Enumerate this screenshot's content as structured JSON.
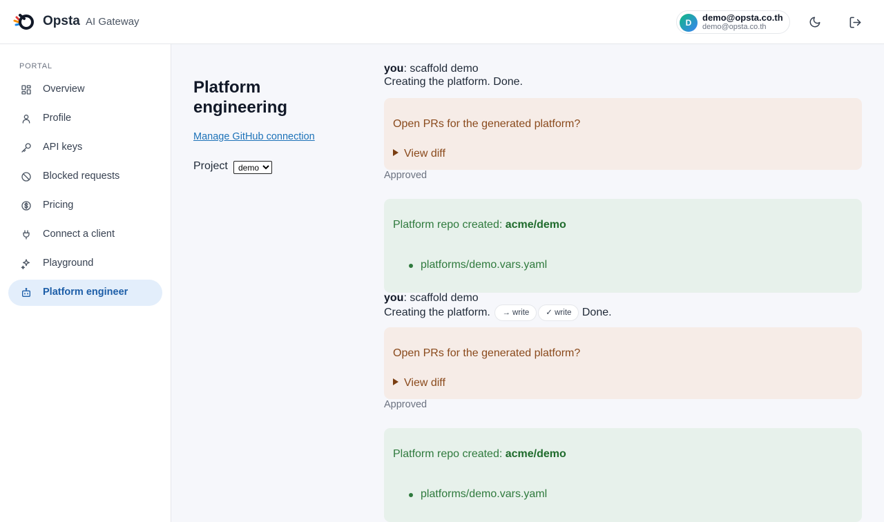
{
  "header": {
    "brand": "Opsta",
    "brand_sub": "AI Gateway",
    "user": {
      "avatar_letter": "D",
      "name": "demo@opsta.co.th",
      "email": "demo@opsta.co.th"
    },
    "theme_toggle_icon": "moon-icon",
    "logout_icon": "logout-icon"
  },
  "sidebar": {
    "section": "PORTAL",
    "items": [
      {
        "label": "Overview",
        "icon": "grid-icon",
        "active": false
      },
      {
        "label": "Profile",
        "icon": "user-icon",
        "active": false
      },
      {
        "label": "API keys",
        "icon": "key-icon",
        "active": false
      },
      {
        "label": "Blocked requests",
        "icon": "ban-icon",
        "active": false
      },
      {
        "label": "Pricing",
        "icon": "dollar-icon",
        "active": false
      },
      {
        "label": "Connect a client",
        "icon": "plug-icon",
        "active": false
      },
      {
        "label": "Playground",
        "icon": "sparkles-icon",
        "active": false
      },
      {
        "label": "Platform engineer",
        "icon": "bot-icon",
        "active": true
      }
    ]
  },
  "main": {
    "title": "Platform engineering",
    "github_link": "Manage GitHub connection",
    "project_label": "Project",
    "project_value": "demo"
  },
  "chat": {
    "blocks": [
      {
        "speaker": "you",
        "message": ": scaffold demo",
        "status_prefix": "Creating the platform.",
        "pills": [],
        "status_suffix": " Done.",
        "pr_question": "Open PRs for the generated platform?",
        "view_diff": "View diff",
        "approved": "Approved",
        "repo_label": "Platform repo created: ",
        "repo_name": "acme/demo",
        "file": "platforms/demo.vars.yaml"
      },
      {
        "speaker": "you",
        "message": ": scaffold demo",
        "status_prefix": "Creating the platform.",
        "pills": [
          "→ write",
          "✓ write"
        ],
        "status_suffix": "Done.",
        "pr_question": "Open PRs for the generated platform?",
        "view_diff": "View diff",
        "approved": "Approved",
        "repo_label": "Platform repo created: ",
        "repo_name": "acme/demo",
        "file": "platforms/demo.vars.yaml"
      }
    ]
  },
  "colors": {
    "active_bg": "#e3eefb",
    "active_text": "#1d5ea8",
    "pr_card_bg": "#f6ece7",
    "pr_card_text": "#8a4a1c",
    "ok_card_bg": "#e7f1eb",
    "ok_card_text": "#2f7a3d"
  }
}
